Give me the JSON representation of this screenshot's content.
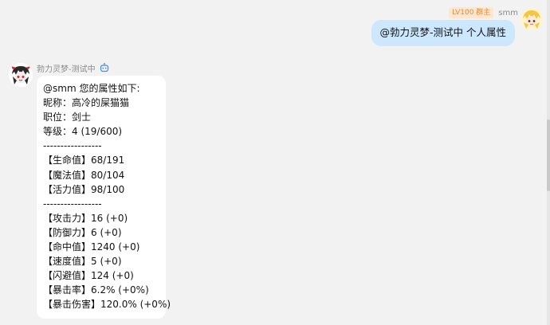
{
  "self_message": {
    "badge": "LV100 群主",
    "username": "smm",
    "text": "@勃力灵梦-测试中 个人属性"
  },
  "bot_message": {
    "username": "勃力灵梦-测试中",
    "badge_icon": "robot-icon",
    "lines": [
      "@smm 您的属性如下:",
      "昵称：高冷的屎猫猫",
      "职位：剑士",
      "等级：4 (19/600)",
      "-----------------",
      "【生命值】68/191",
      "【魔法值】80/104",
      "【活力值】98/100",
      "-----------------",
      "【攻击力】16 (+0)",
      "【防御力】6 (+0)",
      "【命中值】1240 (+0)",
      "【速度值】5 (+0)",
      "【闪避值】124 (+0)",
      "【暴击率】6.2% (+0%)",
      "【暴击伤害】120.0% (+0%)"
    ]
  },
  "colors": {
    "background": "#f2f2f2",
    "self_bubble": "#cde7ff",
    "bot_bubble": "#ffffff",
    "badge_bg": "#ffe6cf",
    "badge_text": "#e08a3c"
  }
}
